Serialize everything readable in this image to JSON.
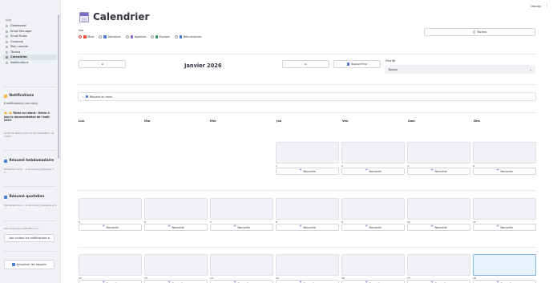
{
  "app": {
    "deploy_label": "Deploy",
    "menu_glyph": "⋮"
  },
  "sidebar": {
    "section_title": "App",
    "items": [
      {
        "label": "Dashboard"
      },
      {
        "label": "Email Manager"
      },
      {
        "label": "Email Rules"
      },
      {
        "label": "Contacts"
      },
      {
        "label": "Mon compte"
      },
      {
        "label": "Tâches"
      },
      {
        "label": "Calendrier",
        "active": true
      },
      {
        "label": "Notifications"
      }
    ],
    "notifications": {
      "title": "Notifications",
      "count_text": "6 notification(s) non lue(s)",
      "item_title": "Tâche en retard : Relire à jour la documentation de l'outil 2025",
      "item_desc": "La tâche 'Relire à jour la documentation de l'outil…"
    },
    "weekly": {
      "title": "Résumé hebdomadaire",
      "text": "Semaine à venir : 1 réunion(s) prévue(s), 2 t…"
    },
    "daily": {
      "title": "Résumé quotidien",
      "text": "Maintenant pour : 1 réunion(s) prévue(s) et 1 …"
    },
    "see_label": "Voir toutes les notifications ici",
    "see_button": "Voir toutes les notifications",
    "update_button": "Actualiser les rappels"
  },
  "header": {
    "title": "Calendrier",
    "tasks_button": "Tâches"
  },
  "view": {
    "label": "Vue",
    "options": [
      {
        "label": "Mois",
        "checked": true,
        "icon_color": "#e0503c"
      },
      {
        "label": "Semaine",
        "checked": false,
        "icon_color": "#4a7bd0"
      },
      {
        "label": "Agenda",
        "checked": false,
        "icon_color": "#8c6bc8"
      },
      {
        "label": "Equipe",
        "checked": false,
        "icon_color": "#3c9a6a"
      },
      {
        "label": "Récurrences",
        "checked": false,
        "icon_color": "#4a7bd0"
      }
    ]
  },
  "nav": {
    "prev": "◂",
    "next": "▸",
    "month": "Janvier 2026",
    "today_button": "Aujourd'hui"
  },
  "filter": {
    "label": "Priorité",
    "value": "Toutes"
  },
  "expander": {
    "label": "Résumé du mois"
  },
  "calendar": {
    "day_headers": [
      "Lun",
      "Mar",
      "Mer",
      "Jeu",
      "Ven",
      "Sam",
      "Dim"
    ],
    "new_label": "Nouvelle",
    "weeks": [
      [
        "",
        "",
        "",
        "1",
        "2",
        "3",
        "4"
      ],
      [
        "5",
        "6",
        "7",
        "8",
        "9",
        "10",
        "11"
      ],
      [
        "12",
        "13",
        "14",
        "15",
        "16",
        "17",
        "18"
      ]
    ],
    "today": "18"
  }
}
